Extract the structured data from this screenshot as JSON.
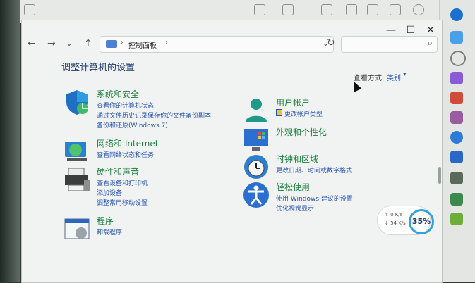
{
  "window": {
    "breadcrumb": "控制面板",
    "controls": {
      "minimize": "—",
      "maximize": "☐",
      "close": "✕"
    },
    "nav": {
      "back": "←",
      "forward": "→",
      "recent": "⌄",
      "up": "↑",
      "refresh": "↻",
      "search_icon": "⌕"
    }
  },
  "heading": "调整计算机的设置",
  "view_by": {
    "label": "查看方式:",
    "value": "类别"
  },
  "categories_left": [
    {
      "icon": "security-shield-icon",
      "title": "系统和安全",
      "links": [
        "查看你的计算机状态",
        "通过文件历史记录保存你的文件备份副本",
        "备份和还原(Windows 7)"
      ]
    },
    {
      "icon": "network-globe-icon",
      "title": "网络和 Internet",
      "links": [
        "查看网络状态和任务"
      ]
    },
    {
      "icon": "printer-icon",
      "title": "硬件和声音",
      "links": [
        "查看设备和打印机",
        "添加设备",
        "调整常用移动设置"
      ]
    },
    {
      "icon": "programs-icon",
      "title": "程序",
      "links": [
        "卸载程序"
      ]
    }
  ],
  "categories_right": [
    {
      "icon": "user-accounts-icon",
      "title": "用户帐户",
      "links": [
        "更改帐户类型"
      ]
    },
    {
      "icon": "appearance-icon",
      "title": "外观和个性化",
      "links": []
    },
    {
      "icon": "clock-globe-icon",
      "title": "时钟和区域",
      "links": [
        "更改日期、时间或数字格式"
      ]
    },
    {
      "icon": "ease-of-access-icon",
      "title": "轻松使用",
      "links": [
        "使用 Windows 建议的设置",
        "优化视觉显示"
      ]
    }
  ],
  "net_widget": {
    "up": "↑ 0 K/s",
    "down": "↓ 54 K/s",
    "percent": "35%"
  },
  "colors": {
    "category_title": "#1a7f3c",
    "link": "#2a56b8",
    "heading": "#1f3b6f"
  }
}
